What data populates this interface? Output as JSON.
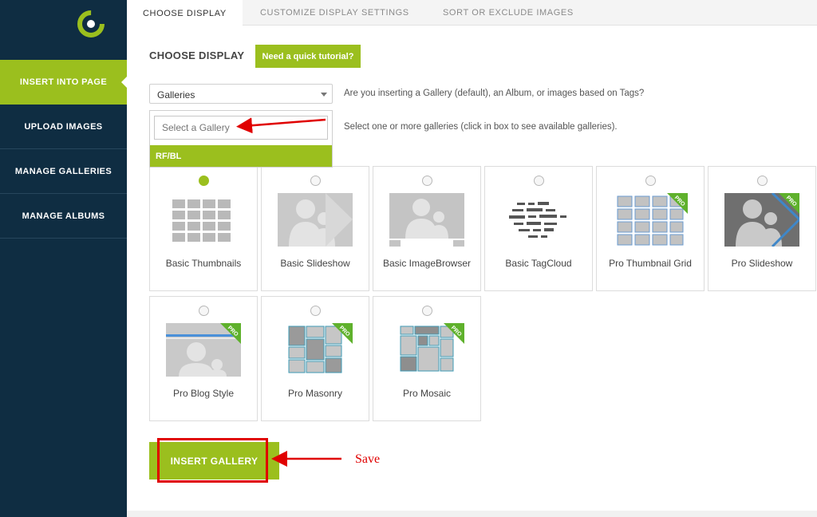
{
  "sidebar": {
    "items": [
      {
        "label": "INSERT INTO PAGE",
        "active": true
      },
      {
        "label": "UPLOAD IMAGES",
        "active": false
      },
      {
        "label": "MANAGE GALLERIES",
        "active": false
      },
      {
        "label": "MANAGE ALBUMS",
        "active": false
      }
    ]
  },
  "tabs": [
    {
      "label": "CHOOSE DISPLAY",
      "active": true
    },
    {
      "label": "CUSTOMIZE DISPLAY SETTINGS",
      "active": false
    },
    {
      "label": "SORT OR EXCLUDE IMAGES",
      "active": false
    }
  ],
  "main": {
    "heading": "CHOOSE DISPLAY",
    "tutorial_label": "Need a quick tutorial?",
    "display_select": {
      "value": "Galleries"
    },
    "display_help": "Are you inserting a Gallery (default), an Album, or images based on Tags?",
    "gallery_search": {
      "placeholder": "Select a Gallery"
    },
    "gallery_help": "Select one or more galleries (click in box to see available galleries).",
    "gallery_option": "RF/BL",
    "insert_label": "INSERT GALLERY",
    "annotation_note": "Save"
  },
  "display_types": [
    {
      "label": "Basic Thumbnails",
      "selected": true,
      "pro": false
    },
    {
      "label": "Basic Slideshow",
      "selected": false,
      "pro": false
    },
    {
      "label": "Basic ImageBrowser",
      "selected": false,
      "pro": false
    },
    {
      "label": "Basic TagCloud",
      "selected": false,
      "pro": false
    },
    {
      "label": "Pro Thumbnail Grid",
      "selected": false,
      "pro": true
    },
    {
      "label": "Pro Slideshow",
      "selected": false,
      "pro": true
    },
    {
      "label": "Pro Blog Style",
      "selected": false,
      "pro": true
    },
    {
      "label": "Pro Masonry",
      "selected": false,
      "pro": true
    },
    {
      "label": "Pro Mosaic",
      "selected": false,
      "pro": true
    }
  ],
  "badge": {
    "label": "PRO"
  },
  "colors": {
    "accent": "#9bbf1e",
    "sidebar": "#0f2d42",
    "annotation": "#e00000"
  },
  "icons": {
    "logo": "nextgen-logo-icon",
    "select_caret": "caret-down-icon"
  }
}
